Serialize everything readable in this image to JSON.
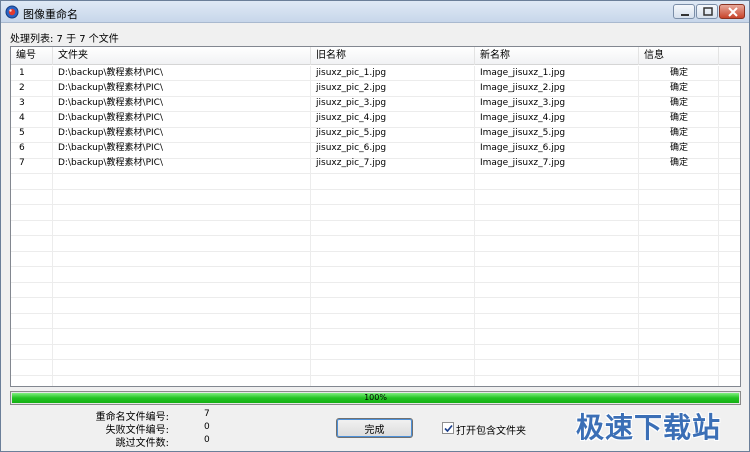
{
  "window": {
    "title": "图像重命名",
    "icon": "app-rename-icon"
  },
  "list": {
    "label": "处理列表: 7 于 7 个文件",
    "columns": [
      "编号",
      "文件夹",
      "旧名称",
      "新名称",
      "信息"
    ],
    "rows": [
      {
        "num": "1",
        "folder": "D:\\backup\\教程素材\\PIC\\",
        "old": "jisuxz_pic_1.jpg",
        "new": "Image_jisuxz_1.jpg",
        "info": "确定"
      },
      {
        "num": "2",
        "folder": "D:\\backup\\教程素材\\PIC\\",
        "old": "jisuxz_pic_2.jpg",
        "new": "Image_jisuxz_2.jpg",
        "info": "确定"
      },
      {
        "num": "3",
        "folder": "D:\\backup\\教程素材\\PIC\\",
        "old": "jisuxz_pic_3.jpg",
        "new": "Image_jisuxz_3.jpg",
        "info": "确定"
      },
      {
        "num": "4",
        "folder": "D:\\backup\\教程素材\\PIC\\",
        "old": "jisuxz_pic_4.jpg",
        "new": "Image_jisuxz_4.jpg",
        "info": "确定"
      },
      {
        "num": "5",
        "folder": "D:\\backup\\教程素材\\PIC\\",
        "old": "jisuxz_pic_5.jpg",
        "new": "Image_jisuxz_5.jpg",
        "info": "确定"
      },
      {
        "num": "6",
        "folder": "D:\\backup\\教程素材\\PIC\\",
        "old": "jisuxz_pic_6.jpg",
        "new": "Image_jisuxz_6.jpg",
        "info": "确定"
      },
      {
        "num": "7",
        "folder": "D:\\backup\\教程素材\\PIC\\",
        "old": "jisuxz_pic_7.jpg",
        "new": "Image_jisuxz_7.jpg",
        "info": "确定"
      }
    ]
  },
  "progress": {
    "value": 1.0,
    "label": "100%",
    "color": "#22c322"
  },
  "stats": {
    "renamed_label": "重命名文件编号:",
    "renamed_value": "7",
    "failed_label": "失败文件编号:",
    "failed_value": "0",
    "skipped_label": "跳过文件数:",
    "skipped_value": "0"
  },
  "actions": {
    "done_label": "完成",
    "open_folder_label": "打开包含文件夹",
    "open_folder_checked": true
  },
  "watermark": {
    "text": "极速下载站",
    "color": "#3b6fb6"
  }
}
